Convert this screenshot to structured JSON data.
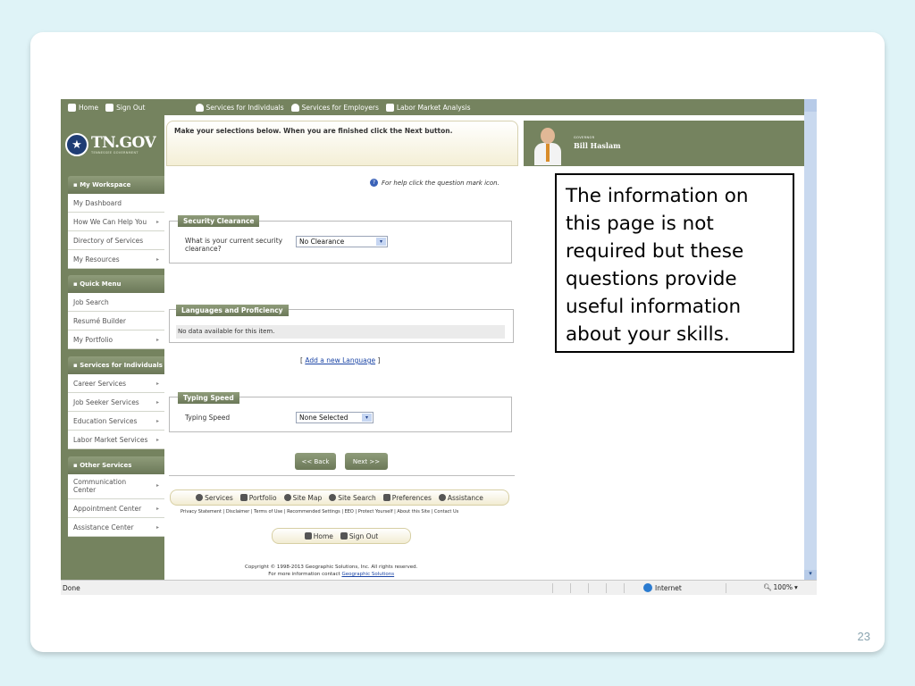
{
  "slide_number": "23",
  "topnav": {
    "home": "Home",
    "sign_out": "Sign Out",
    "services_individuals": "Services for Individuals",
    "services_employers": "Services for Employers",
    "labor_market": "Labor Market Analysis"
  },
  "logo": {
    "text": "TN.GOV",
    "sub": "TENNESSEE GOVERNMENT"
  },
  "governor": {
    "title": "GOVERNOR",
    "name": "Bill Haslam"
  },
  "sidebar": {
    "workspace": {
      "header": "My Workspace",
      "items": [
        "My Dashboard",
        "How We Can Help You",
        "Directory of Services",
        "My Resources"
      ]
    },
    "quick_menu": {
      "header": "Quick Menu",
      "items": [
        "Job Search",
        "Resumé Builder",
        "My Portfolio"
      ]
    },
    "individuals": {
      "header": "Services for Individuals",
      "items": [
        "Career Services",
        "Job Seeker Services",
        "Education Services",
        "Labor Market Services"
      ]
    },
    "other": {
      "header": "Other Services",
      "items": [
        "Communication Center",
        "Appointment Center",
        "Assistance Center"
      ]
    }
  },
  "main": {
    "instruction": "Make your selections below. When you are finished click the Next button.",
    "help_text": "For help click the question mark icon.",
    "security": {
      "legend": "Security Clearance",
      "label": "What is your current security clearance?",
      "value": "No Clearance"
    },
    "languages": {
      "legend": "Languages and Proficiency",
      "nodata": "No data available for this item.",
      "add_link": "Add a new Language",
      "bracket_open": "[",
      "bracket_close": "]"
    },
    "typing": {
      "legend": "Typing Speed",
      "label": "Typing Speed",
      "value": "None Selected"
    },
    "back_button": "<< Back",
    "next_button": "Next >>"
  },
  "footer": {
    "links": [
      "Services",
      "Portfolio",
      "Site Map",
      "Site Search",
      "Preferences",
      "Assistance"
    ],
    "legal": "Privacy Statement | Disclaimer | Terms of Use | Recommended Settings | EEO | Protect Yourself | About this Site | Contact Us",
    "home": "Home",
    "sign_out": "Sign Out",
    "copyright": "Copyright © 1998-2013 Geographic Solutions, Inc. All rights reserved.",
    "more_info": "For more information contact",
    "company_link": "Geographic Solutions"
  },
  "statusbar": {
    "done": "Done",
    "zone": "Internet",
    "zoom": "100%"
  },
  "callout": "The information on this page is not required but these questions provide useful information about your skills."
}
